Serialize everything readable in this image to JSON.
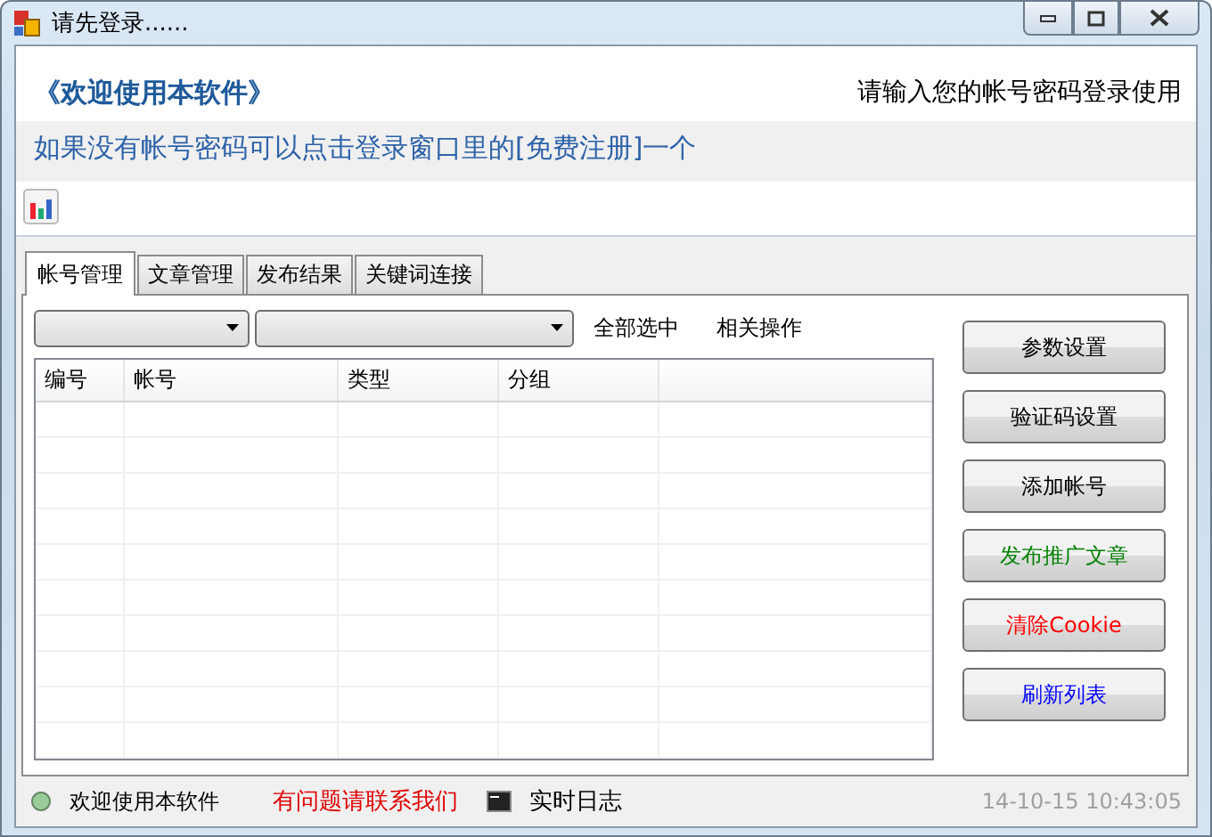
{
  "window": {
    "title": "请先登录......"
  },
  "header": {
    "welcome": "《欢迎使用本软件》",
    "prompt": "请输入您的帐号密码登录使用",
    "notice": "如果没有帐号密码可以点击登录窗口里的[免费注册]一个"
  },
  "tabs": [
    {
      "label": "帐号管理",
      "selected": true
    },
    {
      "label": "文章管理",
      "selected": false
    },
    {
      "label": "发布结果",
      "selected": false
    },
    {
      "label": "关键词连接",
      "selected": false
    }
  ],
  "toolbar": {
    "links": [
      "全部选中",
      "相关操作"
    ]
  },
  "table": {
    "columns": [
      "编号",
      "帐号",
      "类型",
      "分组"
    ]
  },
  "buttons": [
    {
      "label": "参数设置",
      "color": "#000000"
    },
    {
      "label": "验证码设置",
      "color": "#000000"
    },
    {
      "label": "添加帐号",
      "color": "#000000"
    },
    {
      "label": "发布推广文章",
      "color": "#008000"
    },
    {
      "label": "清除Cookie",
      "color": "#ff0000"
    },
    {
      "label": "刷新列表",
      "color": "#0000ff"
    }
  ],
  "status_bar": {
    "welcome": "欢迎使用本软件",
    "contact": "有问题请联系我们",
    "log": "实时日志",
    "time": "14-10-15 10:43:05"
  }
}
